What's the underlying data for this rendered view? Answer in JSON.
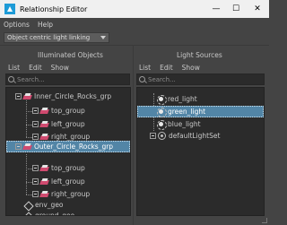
{
  "window": {
    "title": "Relationship Editor",
    "minimize": "—",
    "maximize": "☐",
    "close": "✕"
  },
  "menubar": {
    "items": [
      "Options",
      "Help"
    ]
  },
  "mode": {
    "selected": "Object centric light linking"
  },
  "left_panel": {
    "title": "Illuminated Objects",
    "menu": [
      "List",
      "Edit",
      "Show"
    ],
    "search_placeholder": "Search...",
    "rows": [
      {
        "label": "Inner_Circle_Rocks_grp",
        "selected": false
      },
      {
        "label": "top_group",
        "selected": false
      },
      {
        "label": "left_group",
        "selected": false
      },
      {
        "label": "right_group",
        "selected": false
      },
      {
        "label": "Outer_Circle_Rocks_grp",
        "selected": true
      },
      {
        "label": "top_group",
        "selected": false
      },
      {
        "label": "left_group",
        "selected": false
      },
      {
        "label": "right_group",
        "selected": false
      },
      {
        "label": "env_geo",
        "selected": false
      },
      {
        "label": "ground_geo",
        "selected": false
      }
    ]
  },
  "right_panel": {
    "title": "Light Sources",
    "menu": [
      "List",
      "Edit",
      "Show"
    ],
    "search_placeholder": "Search...",
    "rows": [
      {
        "label": "red_light",
        "selected": false
      },
      {
        "label": "green_light",
        "selected": true
      },
      {
        "label": "blue_light",
        "selected": false
      },
      {
        "label": "defaultLightSet",
        "selected": false
      }
    ]
  },
  "colors": {
    "selection": "#5285a6",
    "group_icon": "#d04a6f",
    "background": "#444444",
    "list_background": "#2b2b2b"
  }
}
